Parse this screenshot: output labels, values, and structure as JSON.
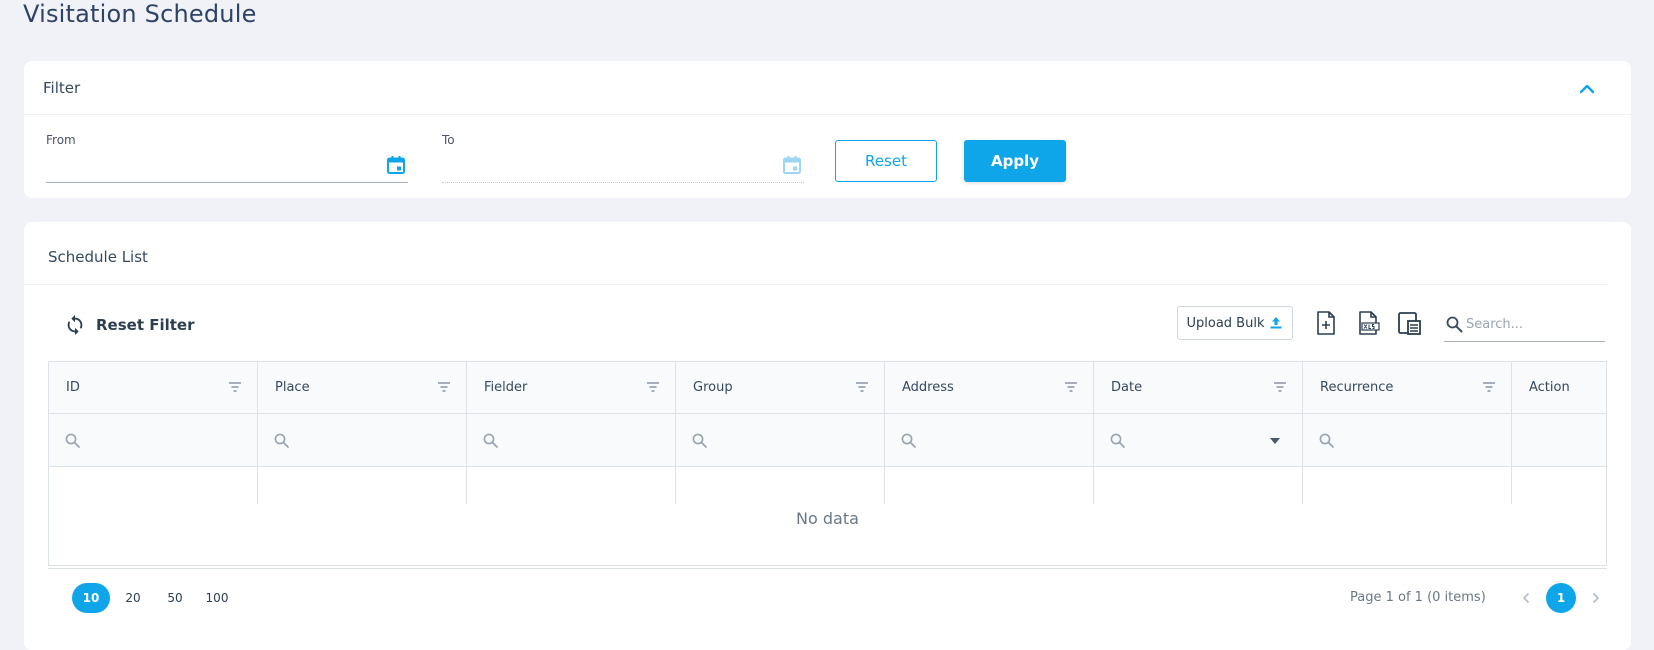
{
  "page": {
    "title": "Visitation Schedule"
  },
  "filter": {
    "title": "Filter",
    "from_label": "From",
    "from_value": "",
    "to_label": "To",
    "to_value": "",
    "reset_label": "Reset",
    "apply_label": "Apply"
  },
  "list": {
    "title": "Schedule List",
    "reset_filter_label": "Reset Filter",
    "upload_bulk_label": "Upload Bulk",
    "search_placeholder": "Search...",
    "columns": [
      {
        "label": "ID"
      },
      {
        "label": "Place"
      },
      {
        "label": "Fielder"
      },
      {
        "label": "Group"
      },
      {
        "label": "Address"
      },
      {
        "label": "Date"
      },
      {
        "label": "Recurrence"
      },
      {
        "label": "Action"
      }
    ],
    "empty_text": "No data"
  },
  "pager": {
    "sizes": [
      "10",
      "20",
      "50",
      "100"
    ],
    "active_size": "10",
    "info": "Page 1 of 1 (0 items)",
    "current_page": "1"
  },
  "colors": {
    "accent": "#0ea5e9",
    "title": "#2e4366"
  }
}
